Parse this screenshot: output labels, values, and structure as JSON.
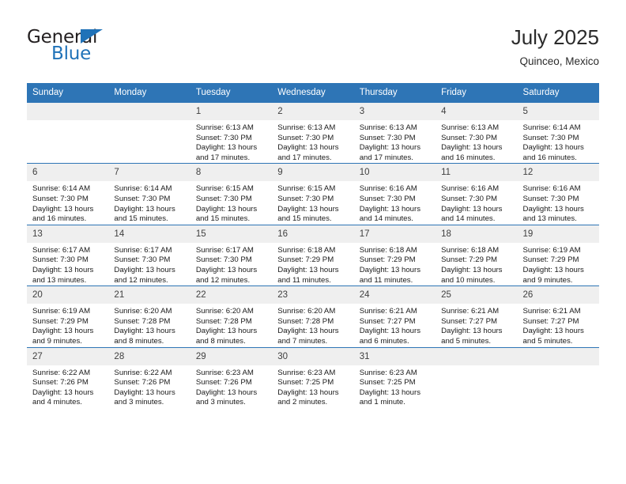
{
  "logo": {
    "word_top": "General",
    "word_bottom": "Blue",
    "triangle_color": "#1f72b8",
    "text_color": "#231f20"
  },
  "header": {
    "title": "July 2025",
    "subtitle": "Quinceo, Mexico"
  },
  "colors": {
    "header_blue": "#2e75b6",
    "daynum_gray": "#efefef",
    "text": "#1a1a1a"
  },
  "weekday_headers": [
    "Sunday",
    "Monday",
    "Tuesday",
    "Wednesday",
    "Thursday",
    "Friday",
    "Saturday"
  ],
  "weeks": [
    [
      {
        "day": "",
        "sunrise": "",
        "sunset": "",
        "daylight1": "",
        "daylight2": ""
      },
      {
        "day": "",
        "sunrise": "",
        "sunset": "",
        "daylight1": "",
        "daylight2": ""
      },
      {
        "day": "1",
        "sunrise": "Sunrise: 6:13 AM",
        "sunset": "Sunset: 7:30 PM",
        "daylight1": "Daylight: 13 hours",
        "daylight2": "and 17 minutes."
      },
      {
        "day": "2",
        "sunrise": "Sunrise: 6:13 AM",
        "sunset": "Sunset: 7:30 PM",
        "daylight1": "Daylight: 13 hours",
        "daylight2": "and 17 minutes."
      },
      {
        "day": "3",
        "sunrise": "Sunrise: 6:13 AM",
        "sunset": "Sunset: 7:30 PM",
        "daylight1": "Daylight: 13 hours",
        "daylight2": "and 17 minutes."
      },
      {
        "day": "4",
        "sunrise": "Sunrise: 6:13 AM",
        "sunset": "Sunset: 7:30 PM",
        "daylight1": "Daylight: 13 hours",
        "daylight2": "and 16 minutes."
      },
      {
        "day": "5",
        "sunrise": "Sunrise: 6:14 AM",
        "sunset": "Sunset: 7:30 PM",
        "daylight1": "Daylight: 13 hours",
        "daylight2": "and 16 minutes."
      }
    ],
    [
      {
        "day": "6",
        "sunrise": "Sunrise: 6:14 AM",
        "sunset": "Sunset: 7:30 PM",
        "daylight1": "Daylight: 13 hours",
        "daylight2": "and 16 minutes."
      },
      {
        "day": "7",
        "sunrise": "Sunrise: 6:14 AM",
        "sunset": "Sunset: 7:30 PM",
        "daylight1": "Daylight: 13 hours",
        "daylight2": "and 15 minutes."
      },
      {
        "day": "8",
        "sunrise": "Sunrise: 6:15 AM",
        "sunset": "Sunset: 7:30 PM",
        "daylight1": "Daylight: 13 hours",
        "daylight2": "and 15 minutes."
      },
      {
        "day": "9",
        "sunrise": "Sunrise: 6:15 AM",
        "sunset": "Sunset: 7:30 PM",
        "daylight1": "Daylight: 13 hours",
        "daylight2": "and 15 minutes."
      },
      {
        "day": "10",
        "sunrise": "Sunrise: 6:16 AM",
        "sunset": "Sunset: 7:30 PM",
        "daylight1": "Daylight: 13 hours",
        "daylight2": "and 14 minutes."
      },
      {
        "day": "11",
        "sunrise": "Sunrise: 6:16 AM",
        "sunset": "Sunset: 7:30 PM",
        "daylight1": "Daylight: 13 hours",
        "daylight2": "and 14 minutes."
      },
      {
        "day": "12",
        "sunrise": "Sunrise: 6:16 AM",
        "sunset": "Sunset: 7:30 PM",
        "daylight1": "Daylight: 13 hours",
        "daylight2": "and 13 minutes."
      }
    ],
    [
      {
        "day": "13",
        "sunrise": "Sunrise: 6:17 AM",
        "sunset": "Sunset: 7:30 PM",
        "daylight1": "Daylight: 13 hours",
        "daylight2": "and 13 minutes."
      },
      {
        "day": "14",
        "sunrise": "Sunrise: 6:17 AM",
        "sunset": "Sunset: 7:30 PM",
        "daylight1": "Daylight: 13 hours",
        "daylight2": "and 12 minutes."
      },
      {
        "day": "15",
        "sunrise": "Sunrise: 6:17 AM",
        "sunset": "Sunset: 7:30 PM",
        "daylight1": "Daylight: 13 hours",
        "daylight2": "and 12 minutes."
      },
      {
        "day": "16",
        "sunrise": "Sunrise: 6:18 AM",
        "sunset": "Sunset: 7:29 PM",
        "daylight1": "Daylight: 13 hours",
        "daylight2": "and 11 minutes."
      },
      {
        "day": "17",
        "sunrise": "Sunrise: 6:18 AM",
        "sunset": "Sunset: 7:29 PM",
        "daylight1": "Daylight: 13 hours",
        "daylight2": "and 11 minutes."
      },
      {
        "day": "18",
        "sunrise": "Sunrise: 6:18 AM",
        "sunset": "Sunset: 7:29 PM",
        "daylight1": "Daylight: 13 hours",
        "daylight2": "and 10 minutes."
      },
      {
        "day": "19",
        "sunrise": "Sunrise: 6:19 AM",
        "sunset": "Sunset: 7:29 PM",
        "daylight1": "Daylight: 13 hours",
        "daylight2": "and 9 minutes."
      }
    ],
    [
      {
        "day": "20",
        "sunrise": "Sunrise: 6:19 AM",
        "sunset": "Sunset: 7:29 PM",
        "daylight1": "Daylight: 13 hours",
        "daylight2": "and 9 minutes."
      },
      {
        "day": "21",
        "sunrise": "Sunrise: 6:20 AM",
        "sunset": "Sunset: 7:28 PM",
        "daylight1": "Daylight: 13 hours",
        "daylight2": "and 8 minutes."
      },
      {
        "day": "22",
        "sunrise": "Sunrise: 6:20 AM",
        "sunset": "Sunset: 7:28 PM",
        "daylight1": "Daylight: 13 hours",
        "daylight2": "and 8 minutes."
      },
      {
        "day": "23",
        "sunrise": "Sunrise: 6:20 AM",
        "sunset": "Sunset: 7:28 PM",
        "daylight1": "Daylight: 13 hours",
        "daylight2": "and 7 minutes."
      },
      {
        "day": "24",
        "sunrise": "Sunrise: 6:21 AM",
        "sunset": "Sunset: 7:27 PM",
        "daylight1": "Daylight: 13 hours",
        "daylight2": "and 6 minutes."
      },
      {
        "day": "25",
        "sunrise": "Sunrise: 6:21 AM",
        "sunset": "Sunset: 7:27 PM",
        "daylight1": "Daylight: 13 hours",
        "daylight2": "and 5 minutes."
      },
      {
        "day": "26",
        "sunrise": "Sunrise: 6:21 AM",
        "sunset": "Sunset: 7:27 PM",
        "daylight1": "Daylight: 13 hours",
        "daylight2": "and 5 minutes."
      }
    ],
    [
      {
        "day": "27",
        "sunrise": "Sunrise: 6:22 AM",
        "sunset": "Sunset: 7:26 PM",
        "daylight1": "Daylight: 13 hours",
        "daylight2": "and 4 minutes."
      },
      {
        "day": "28",
        "sunrise": "Sunrise: 6:22 AM",
        "sunset": "Sunset: 7:26 PM",
        "daylight1": "Daylight: 13 hours",
        "daylight2": "and 3 minutes."
      },
      {
        "day": "29",
        "sunrise": "Sunrise: 6:23 AM",
        "sunset": "Sunset: 7:26 PM",
        "daylight1": "Daylight: 13 hours",
        "daylight2": "and 3 minutes."
      },
      {
        "day": "30",
        "sunrise": "Sunrise: 6:23 AM",
        "sunset": "Sunset: 7:25 PM",
        "daylight1": "Daylight: 13 hours",
        "daylight2": "and 2 minutes."
      },
      {
        "day": "31",
        "sunrise": "Sunrise: 6:23 AM",
        "sunset": "Sunset: 7:25 PM",
        "daylight1": "Daylight: 13 hours",
        "daylight2": "and 1 minute."
      },
      {
        "day": "",
        "sunrise": "",
        "sunset": "",
        "daylight1": "",
        "daylight2": ""
      },
      {
        "day": "",
        "sunrise": "",
        "sunset": "",
        "daylight1": "",
        "daylight2": ""
      }
    ]
  ]
}
